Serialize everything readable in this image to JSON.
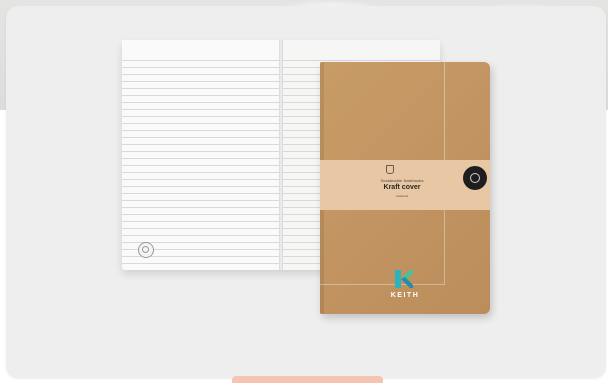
{
  "notebook": {
    "band_brand_line": "Sustainable Notebooks",
    "band_title": "Kraft cover",
    "band_subline": "notebook",
    "logo_text": "KEITH"
  },
  "colors": {
    "card": "#eeeeee",
    "kraft": "#c29462",
    "band": "#e8c8a4",
    "logo_teal": "#2bb3c0",
    "logo_green": "#3fc59a",
    "scroll_pill": "#f6c4b3"
  },
  "icons": {
    "recycle_badge": "recycle-icon",
    "band_emblem": "leaf-icon",
    "band_seal": "seal-icon"
  }
}
